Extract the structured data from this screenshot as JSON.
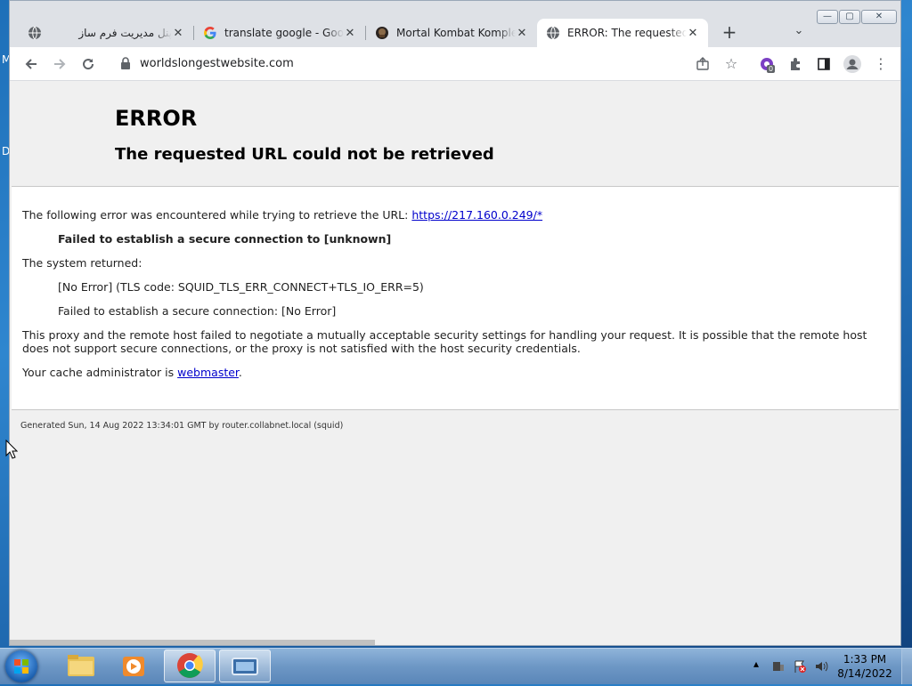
{
  "desktop": {
    "labels": [
      "M",
      "D"
    ]
  },
  "browser": {
    "tabs": [
      {
        "title": "پنل مدیریت فرم ساز",
        "favicon": "globe-icon",
        "active": false
      },
      {
        "title": "translate google - Goog",
        "favicon": "google-icon",
        "active": false
      },
      {
        "title": "Mortal Kombat Komplet",
        "favicon": "mortal-kombat-icon",
        "active": false
      },
      {
        "title": "ERROR: The requested U",
        "favicon": "globe-icon",
        "active": true
      }
    ],
    "new_tab": "+",
    "url": "worldslongestwebsite.com",
    "extension_badge": "0"
  },
  "page": {
    "title": "ERROR",
    "subtitle": "The requested URL could not be retrieved",
    "error_intro": "The following error was encountered while trying to retrieve the URL:",
    "error_url": "https://217.160.0.249/*",
    "error_summary": "Failed to establish a secure connection to [unknown]",
    "system_returned": "The system returned:",
    "no_error": "[No Error] (TLS code: SQUID_TLS_ERR_CONNECT+TLS_IO_ERR=5)",
    "secure_failed": "Failed to establish a secure connection: [No Error]",
    "explanation": "This proxy and the remote host failed to negotiate a mutually acceptable security settings for handling your request. It is possible that the remote host does not support secure connections, or the proxy is not satisfied with the host security credentials.",
    "admin_prefix": "Your cache administrator is",
    "admin_link": "webmaster",
    "admin_suffix": ".",
    "footer": "Generated Sun, 14 Aug 2022 13:34:01 GMT by router.collabnet.local (squid)"
  },
  "taskbar": {
    "time": "1:33 PM",
    "date": "8/14/2022"
  }
}
